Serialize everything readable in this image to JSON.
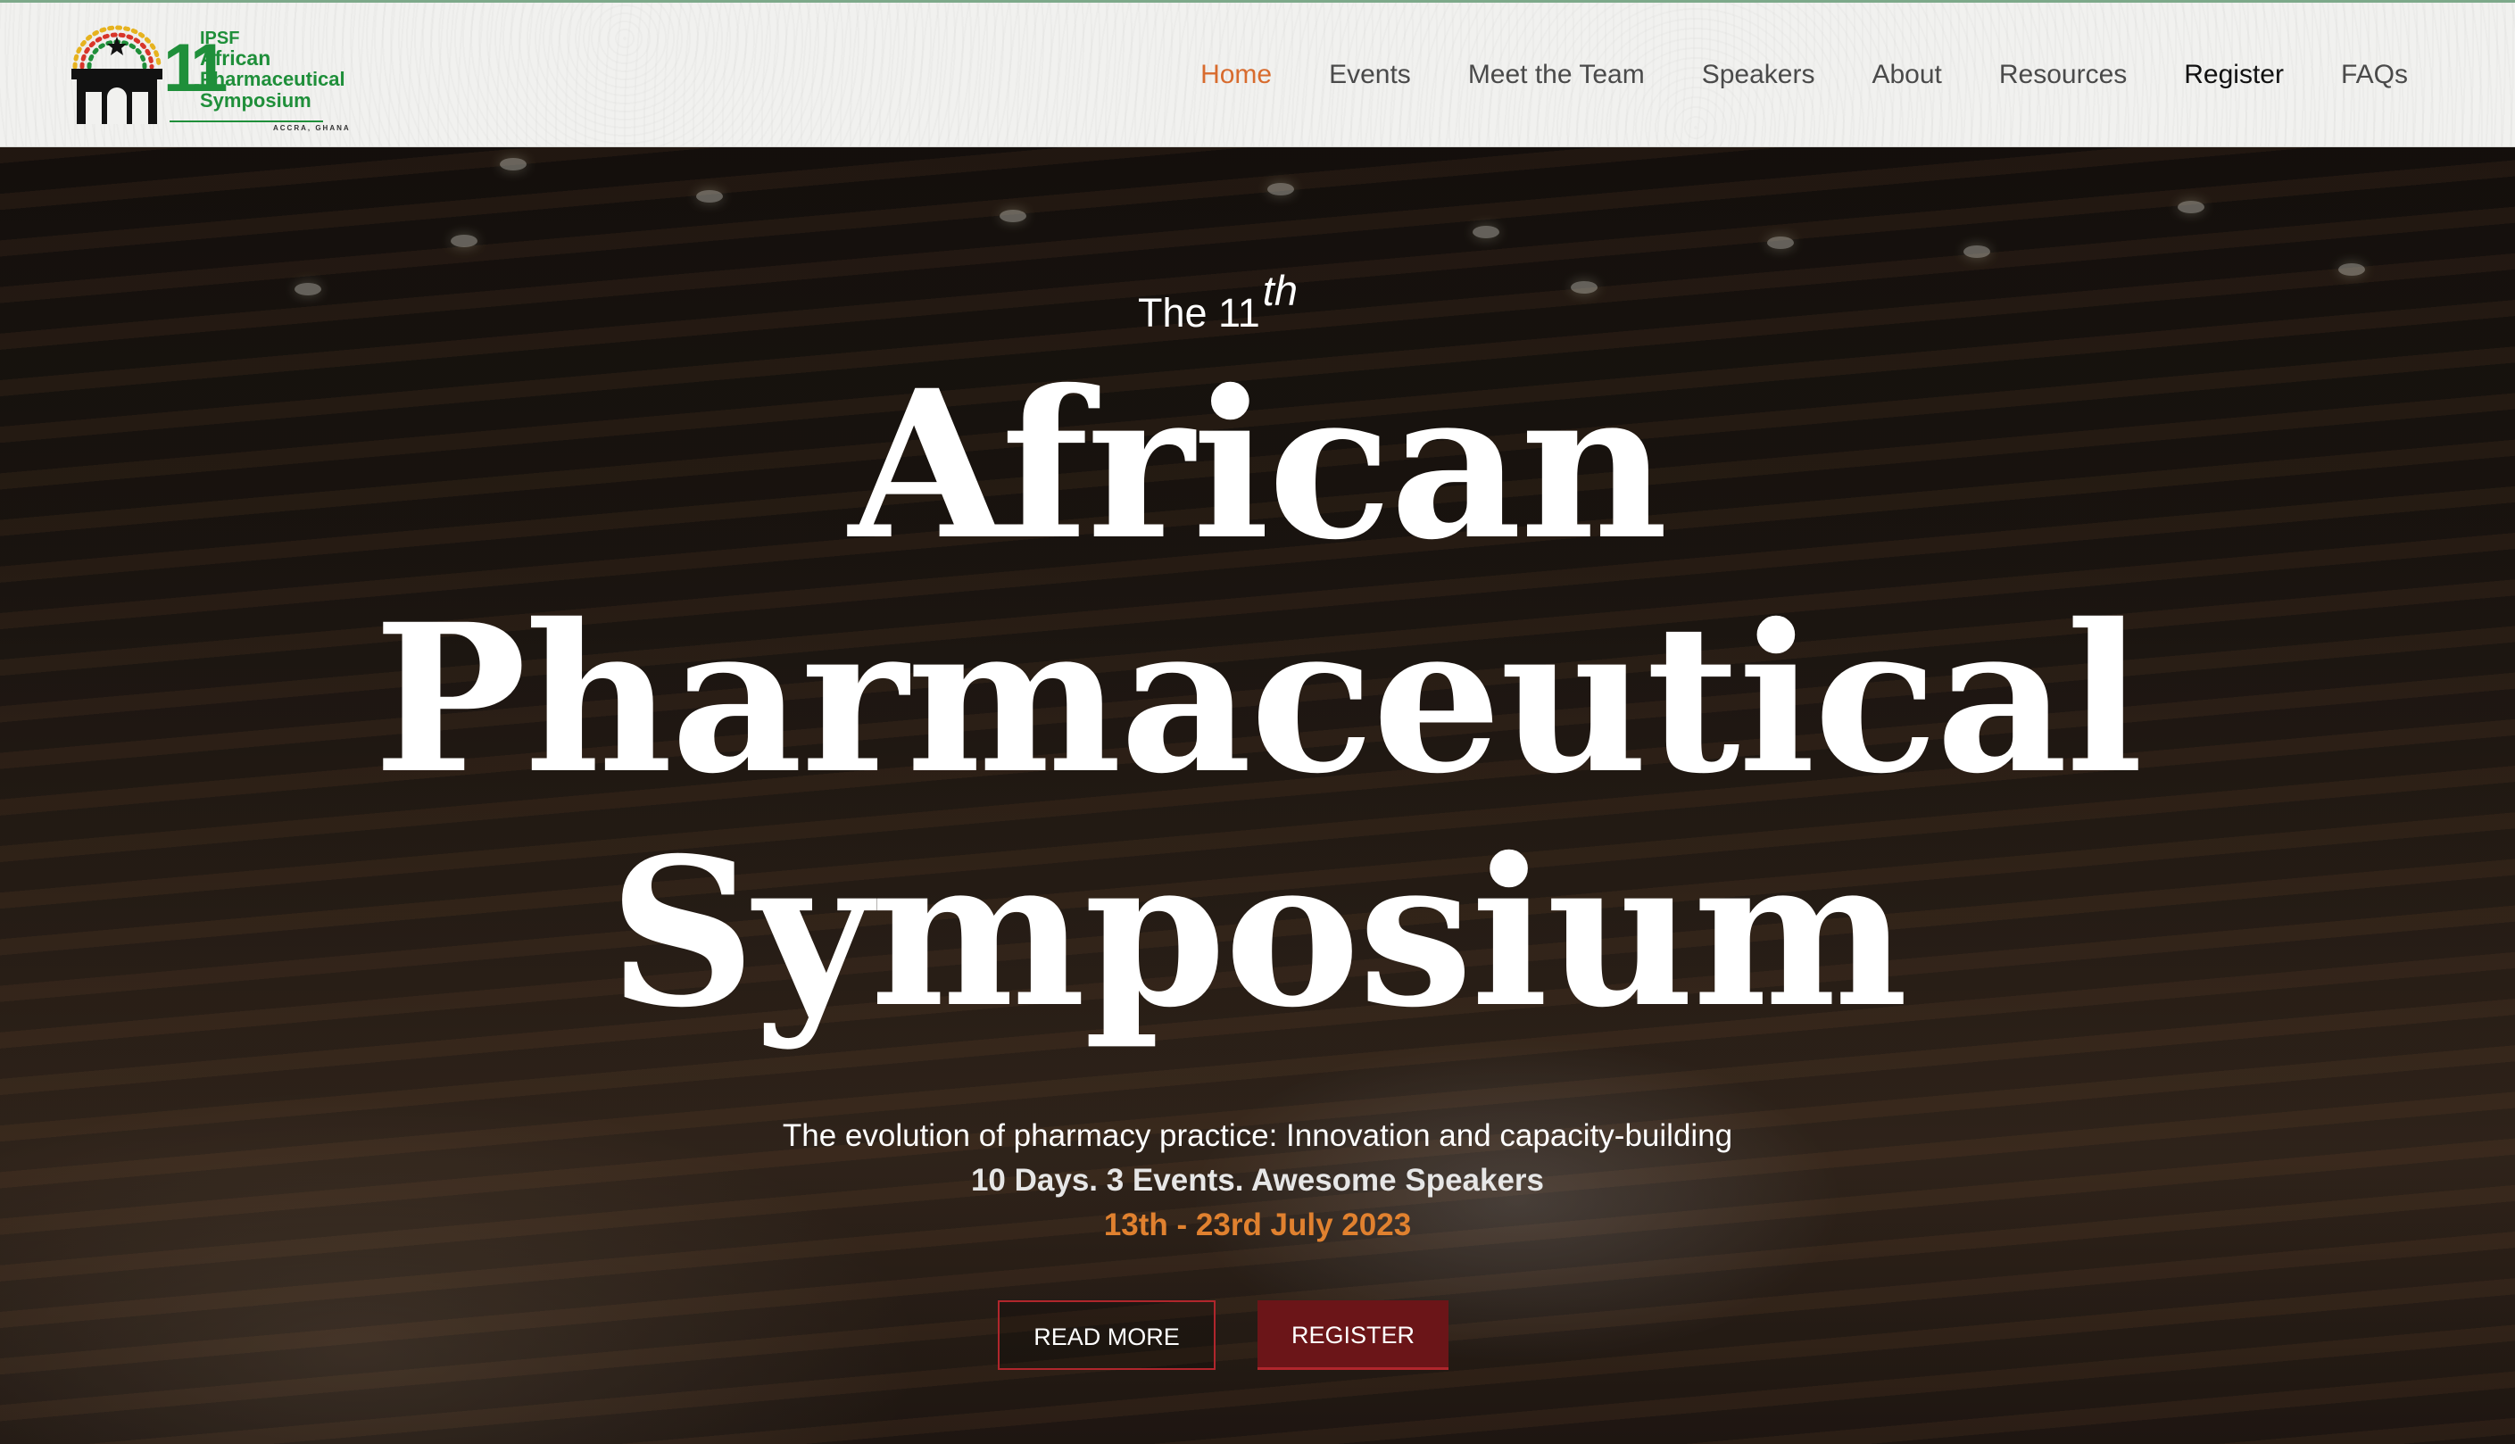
{
  "logo": {
    "number": "11",
    "line1": "IPSF",
    "line2": "African",
    "line3": "Pharmaceutical",
    "line4": "Symposium",
    "location": "ACCRA, GHANA"
  },
  "nav": {
    "items": [
      "Home",
      "Events",
      "Meet the Team",
      "Speakers",
      "About",
      "Resources",
      "Register",
      "FAQs"
    ],
    "active": "Home"
  },
  "hero": {
    "pre_text": "The 11",
    "pre_sup": "th",
    "title_line1": "African",
    "title_line2": "Pharmaceutical",
    "title_line3": "Symposium",
    "subtitle": "The evolution of pharmacy practice: Innovation and capacity-building",
    "tagline": "10 Days. 3 Events. Awesome Speakers",
    "dates": "13th - 23rd July 2023",
    "read_more_label": "READ MORE",
    "register_label": "REGISTER"
  },
  "colors": {
    "accent_orange": "#d86b2d",
    "brand_green": "#1f8f3a",
    "button_red": "#b0262c",
    "button_dark_red": "#6b1518"
  }
}
